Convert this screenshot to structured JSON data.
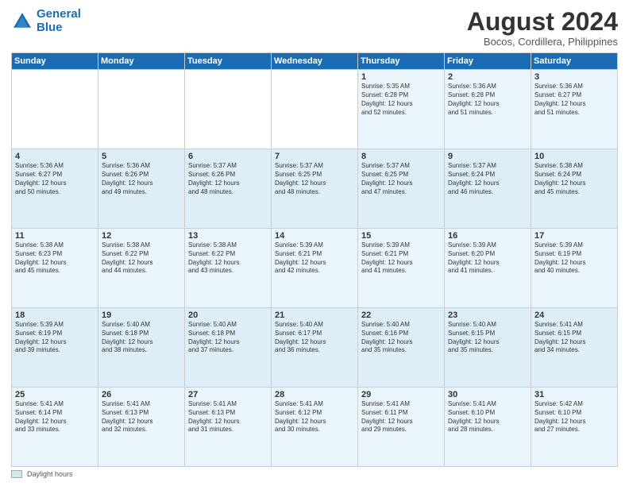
{
  "logo": {
    "line1": "General",
    "line2": "Blue"
  },
  "title": "August 2024",
  "subtitle": "Bocos, Cordillera, Philippines",
  "days_of_week": [
    "Sunday",
    "Monday",
    "Tuesday",
    "Wednesday",
    "Thursday",
    "Friday",
    "Saturday"
  ],
  "weeks": [
    [
      {
        "day": "",
        "info": ""
      },
      {
        "day": "",
        "info": ""
      },
      {
        "day": "",
        "info": ""
      },
      {
        "day": "",
        "info": ""
      },
      {
        "day": "1",
        "info": "Sunrise: 5:35 AM\nSunset: 6:28 PM\nDaylight: 12 hours\nand 52 minutes."
      },
      {
        "day": "2",
        "info": "Sunrise: 5:36 AM\nSunset: 6:28 PM\nDaylight: 12 hours\nand 51 minutes."
      },
      {
        "day": "3",
        "info": "Sunrise: 5:36 AM\nSunset: 6:27 PM\nDaylight: 12 hours\nand 51 minutes."
      }
    ],
    [
      {
        "day": "4",
        "info": "Sunrise: 5:36 AM\nSunset: 6:27 PM\nDaylight: 12 hours\nand 50 minutes."
      },
      {
        "day": "5",
        "info": "Sunrise: 5:36 AM\nSunset: 6:26 PM\nDaylight: 12 hours\nand 49 minutes."
      },
      {
        "day": "6",
        "info": "Sunrise: 5:37 AM\nSunset: 6:26 PM\nDaylight: 12 hours\nand 48 minutes."
      },
      {
        "day": "7",
        "info": "Sunrise: 5:37 AM\nSunset: 6:25 PM\nDaylight: 12 hours\nand 48 minutes."
      },
      {
        "day": "8",
        "info": "Sunrise: 5:37 AM\nSunset: 6:25 PM\nDaylight: 12 hours\nand 47 minutes."
      },
      {
        "day": "9",
        "info": "Sunrise: 5:37 AM\nSunset: 6:24 PM\nDaylight: 12 hours\nand 46 minutes."
      },
      {
        "day": "10",
        "info": "Sunrise: 5:38 AM\nSunset: 6:24 PM\nDaylight: 12 hours\nand 45 minutes."
      }
    ],
    [
      {
        "day": "11",
        "info": "Sunrise: 5:38 AM\nSunset: 6:23 PM\nDaylight: 12 hours\nand 45 minutes."
      },
      {
        "day": "12",
        "info": "Sunrise: 5:38 AM\nSunset: 6:22 PM\nDaylight: 12 hours\nand 44 minutes."
      },
      {
        "day": "13",
        "info": "Sunrise: 5:38 AM\nSunset: 6:22 PM\nDaylight: 12 hours\nand 43 minutes."
      },
      {
        "day": "14",
        "info": "Sunrise: 5:39 AM\nSunset: 6:21 PM\nDaylight: 12 hours\nand 42 minutes."
      },
      {
        "day": "15",
        "info": "Sunrise: 5:39 AM\nSunset: 6:21 PM\nDaylight: 12 hours\nand 41 minutes."
      },
      {
        "day": "16",
        "info": "Sunrise: 5:39 AM\nSunset: 6:20 PM\nDaylight: 12 hours\nand 41 minutes."
      },
      {
        "day": "17",
        "info": "Sunrise: 5:39 AM\nSunset: 6:19 PM\nDaylight: 12 hours\nand 40 minutes."
      }
    ],
    [
      {
        "day": "18",
        "info": "Sunrise: 5:39 AM\nSunset: 6:19 PM\nDaylight: 12 hours\nand 39 minutes."
      },
      {
        "day": "19",
        "info": "Sunrise: 5:40 AM\nSunset: 6:18 PM\nDaylight: 12 hours\nand 38 minutes."
      },
      {
        "day": "20",
        "info": "Sunrise: 5:40 AM\nSunset: 6:18 PM\nDaylight: 12 hours\nand 37 minutes."
      },
      {
        "day": "21",
        "info": "Sunrise: 5:40 AM\nSunset: 6:17 PM\nDaylight: 12 hours\nand 36 minutes."
      },
      {
        "day": "22",
        "info": "Sunrise: 5:40 AM\nSunset: 6:16 PM\nDaylight: 12 hours\nand 35 minutes."
      },
      {
        "day": "23",
        "info": "Sunrise: 5:40 AM\nSunset: 6:15 PM\nDaylight: 12 hours\nand 35 minutes."
      },
      {
        "day": "24",
        "info": "Sunrise: 5:41 AM\nSunset: 6:15 PM\nDaylight: 12 hours\nand 34 minutes."
      }
    ],
    [
      {
        "day": "25",
        "info": "Sunrise: 5:41 AM\nSunset: 6:14 PM\nDaylight: 12 hours\nand 33 minutes."
      },
      {
        "day": "26",
        "info": "Sunrise: 5:41 AM\nSunset: 6:13 PM\nDaylight: 12 hours\nand 32 minutes."
      },
      {
        "day": "27",
        "info": "Sunrise: 5:41 AM\nSunset: 6:13 PM\nDaylight: 12 hours\nand 31 minutes."
      },
      {
        "day": "28",
        "info": "Sunrise: 5:41 AM\nSunset: 6:12 PM\nDaylight: 12 hours\nand 30 minutes."
      },
      {
        "day": "29",
        "info": "Sunrise: 5:41 AM\nSunset: 6:11 PM\nDaylight: 12 hours\nand 29 minutes."
      },
      {
        "day": "30",
        "info": "Sunrise: 5:41 AM\nSunset: 6:10 PM\nDaylight: 12 hours\nand 28 minutes."
      },
      {
        "day": "31",
        "info": "Sunrise: 5:42 AM\nSunset: 6:10 PM\nDaylight: 12 hours\nand 27 minutes."
      }
    ]
  ],
  "footer": {
    "legend_label": "Daylight hours"
  }
}
